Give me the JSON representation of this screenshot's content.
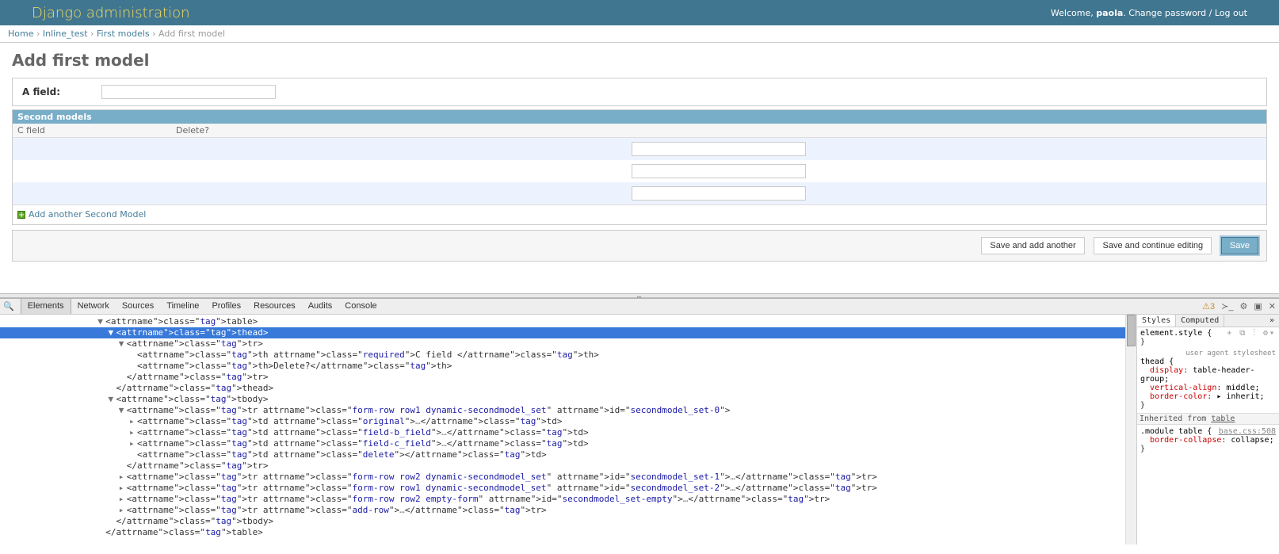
{
  "header": {
    "brand": "Django administration",
    "welcome": "Welcome, ",
    "username": "paola",
    "change_password": "Change password",
    "logout": "Log out"
  },
  "breadcrumbs": {
    "home": "Home",
    "app": "Inline_test",
    "model": "First models",
    "current": "Add first model"
  },
  "page": {
    "title": "Add first model",
    "a_field_label": "A field:"
  },
  "inline": {
    "heading": "Second models",
    "col_cfield": "C field",
    "col_delete": "Delete?",
    "add_another": "Add another Second Model",
    "rows": 3
  },
  "submit": {
    "save_add": "Save and add another",
    "save_cont": "Save and continue editing",
    "save": "Save"
  },
  "devtools": {
    "tabs": [
      "Elements",
      "Network",
      "Sources",
      "Timeline",
      "Profiles",
      "Resources",
      "Audits",
      "Console"
    ],
    "active_tab": 0,
    "warn_count": "3",
    "style_tabs": [
      "Styles",
      "Computed"
    ],
    "element_style": "element.style {",
    "ua_label": "user agent stylesheet",
    "thead_rule": {
      "selector": "thead {",
      "props": [
        [
          "display",
          "table-header-group;"
        ],
        [
          "vertical-align",
          "middle;"
        ],
        [
          "border-color",
          "▸ inherit;"
        ]
      ]
    },
    "inherited_label": "Inherited from ",
    "inherited_from": "table",
    "module_rule_src": "base.css:508",
    "module_rule_sel": ".module table {",
    "module_rule_prop": [
      "border-collapse",
      "collapse;"
    ]
  },
  "dom_tree": [
    {
      "indent": 9,
      "arrow": "▼",
      "html": "<table>"
    },
    {
      "indent": 10,
      "arrow": "▼",
      "html": "<thead>",
      "selected": true
    },
    {
      "indent": 11,
      "arrow": "▼",
      "html": "<tr>"
    },
    {
      "indent": 12,
      "arrow": "",
      "html": "<th class=\"required\">C field </th>"
    },
    {
      "indent": 12,
      "arrow": "",
      "html": "<th>Delete?</th>"
    },
    {
      "indent": 11,
      "arrow": "",
      "html": "</tr>"
    },
    {
      "indent": 10,
      "arrow": "",
      "html": "</thead>"
    },
    {
      "indent": 10,
      "arrow": "▼",
      "html": "<tbody>"
    },
    {
      "indent": 11,
      "arrow": "▼",
      "html": "<tr class=\"form-row row1 dynamic-secondmodel_set\" id=\"secondmodel_set-0\">"
    },
    {
      "indent": 12,
      "arrow": "▸",
      "html": "<td class=\"original\">…</td>"
    },
    {
      "indent": 12,
      "arrow": "▸",
      "html": "<td class=\"field-b_field\">…</td>"
    },
    {
      "indent": 12,
      "arrow": "▸",
      "html": "<td class=\"field-c_field\">…</td>"
    },
    {
      "indent": 12,
      "arrow": "",
      "html": "<td class=\"delete\"></td>"
    },
    {
      "indent": 11,
      "arrow": "",
      "html": "</tr>"
    },
    {
      "indent": 11,
      "arrow": "▸",
      "html": "<tr class=\"form-row row2 dynamic-secondmodel_set\" id=\"secondmodel_set-1\">…</tr>"
    },
    {
      "indent": 11,
      "arrow": "▸",
      "html": "<tr class=\"form-row row1 dynamic-secondmodel_set\" id=\"secondmodel_set-2\">…</tr>"
    },
    {
      "indent": 11,
      "arrow": "▸",
      "html": "<tr class=\"form-row row2 empty-form\" id=\"secondmodel_set-empty\">…</tr>"
    },
    {
      "indent": 11,
      "arrow": "▸",
      "html": "<tr class=\"add-row\">…</tr>"
    },
    {
      "indent": 10,
      "arrow": "",
      "html": "</tbody>"
    },
    {
      "indent": 9,
      "arrow": "",
      "html": "</table>"
    }
  ]
}
